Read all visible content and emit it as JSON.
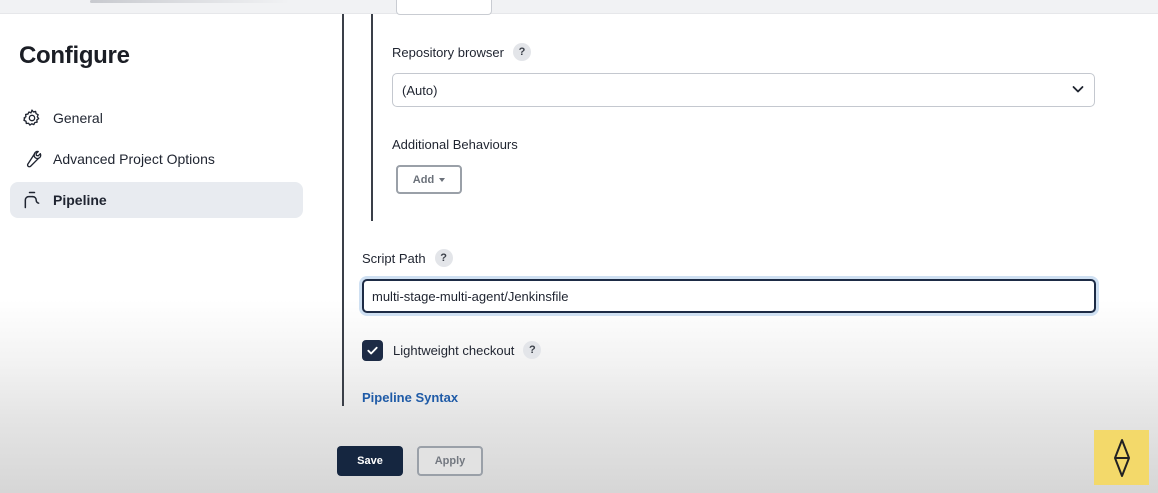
{
  "sidebar": {
    "title": "Configure",
    "items": [
      {
        "label": "General",
        "icon": "gear-icon"
      },
      {
        "label": "Advanced Project Options",
        "icon": "wrench-icon"
      },
      {
        "label": "Pipeline",
        "icon": "pipeline-icon",
        "active": true
      }
    ]
  },
  "main": {
    "repository_browser": {
      "label": "Repository browser",
      "help": "?",
      "selected": "(Auto)"
    },
    "additional_behaviours": {
      "label": "Additional Behaviours",
      "add_label": "Add"
    },
    "script_path": {
      "label": "Script Path",
      "help": "?",
      "value": "multi-stage-multi-agent/Jenkinsfile"
    },
    "lightweight_checkout": {
      "label": "Lightweight checkout",
      "help": "?",
      "checked": true
    },
    "pipeline_syntax_link": "Pipeline Syntax"
  },
  "footer": {
    "save_label": "Save",
    "apply_label": "Apply"
  },
  "colors": {
    "accent": "#1d2b45",
    "link": "#1f5ba7",
    "logo_bg": "#f3d96a"
  }
}
